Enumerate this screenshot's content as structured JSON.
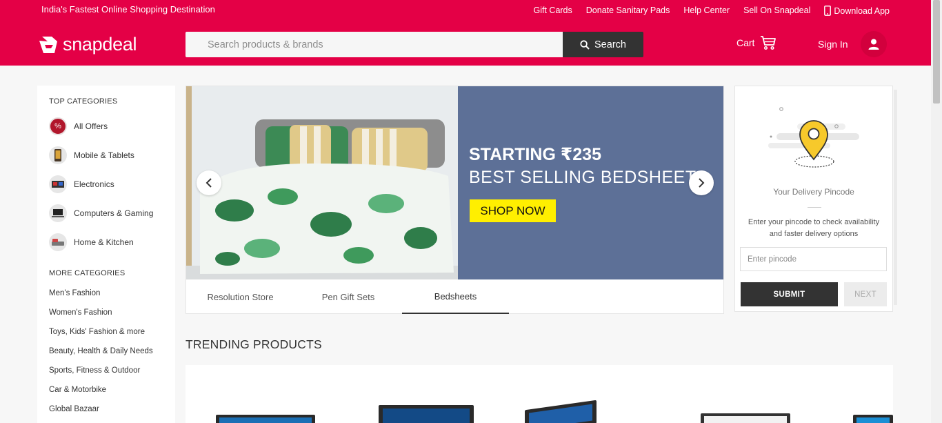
{
  "top_strip": {
    "tagline": "India's Fastest Online Shopping Destination",
    "links": [
      "Gift Cards",
      "Donate Sanitary Pads",
      "Help Center",
      "Sell On Snapdeal"
    ],
    "download_app": "Download App"
  },
  "header": {
    "logo_text": "snapdeal",
    "search_placeholder": "Search products & brands",
    "search_button": "Search",
    "cart_label": "Cart",
    "signin_label": "Sign In"
  },
  "sidebar": {
    "top_heading": "TOP CATEGORIES",
    "top_items": [
      {
        "label": "All Offers",
        "icon": "percent-icon"
      },
      {
        "label": "Mobile & Tablets",
        "icon": "mobile-icon"
      },
      {
        "label": "Electronics",
        "icon": "electronics-icon"
      },
      {
        "label": "Computers & Gaming",
        "icon": "computer-icon"
      },
      {
        "label": "Home & Kitchen",
        "icon": "home-kitchen-icon"
      }
    ],
    "more_heading": "MORE CATEGORIES",
    "more_items": [
      "Men's Fashion",
      "Women's Fashion",
      "Toys, Kids' Fashion & more",
      "Beauty, Health & Daily Needs",
      "Sports, Fitness & Outdoor",
      "Car & Motorbike",
      "Global Bazaar"
    ]
  },
  "banner": {
    "line1": "STARTING ₹235",
    "line2": "BEST SELLING BEDSHEETS",
    "cta": "SHOP NOW",
    "tabs": [
      "Resolution Store",
      "Pen Gift Sets",
      "Bedsheets"
    ],
    "active_tab": "Bedsheets"
  },
  "pincode": {
    "title": "Your Delivery Pincode",
    "description": "Enter your pincode to check availability and faster delivery options",
    "placeholder": "Enter pincode",
    "submit": "SUBMIT",
    "next": "NEXT"
  },
  "trending": {
    "title": "TRENDING PRODUCTS"
  },
  "colors": {
    "brand": "#e40046",
    "banner_panel": "#5d7097",
    "cta": "#ffef00",
    "dark_button": "#333333"
  }
}
